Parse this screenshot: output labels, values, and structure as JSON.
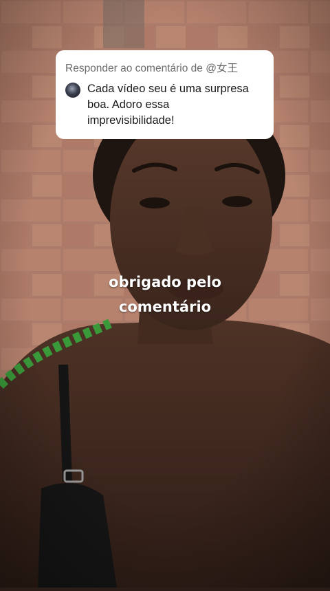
{
  "reply_card": {
    "header": "Responder ao comentário de @女王",
    "comment": "Cada vídeo seu é uma surpresa boa. Adoro essa imprevisibilidade!",
    "avatar_icon": "user-avatar"
  },
  "caption": {
    "line1": "obrigado pelo",
    "line2": "comentário"
  },
  "colors": {
    "card_background": "#ffffff",
    "header_text": "#6b6b6b",
    "comment_text": "#1a1a1a",
    "caption_text": "#ffffff"
  }
}
